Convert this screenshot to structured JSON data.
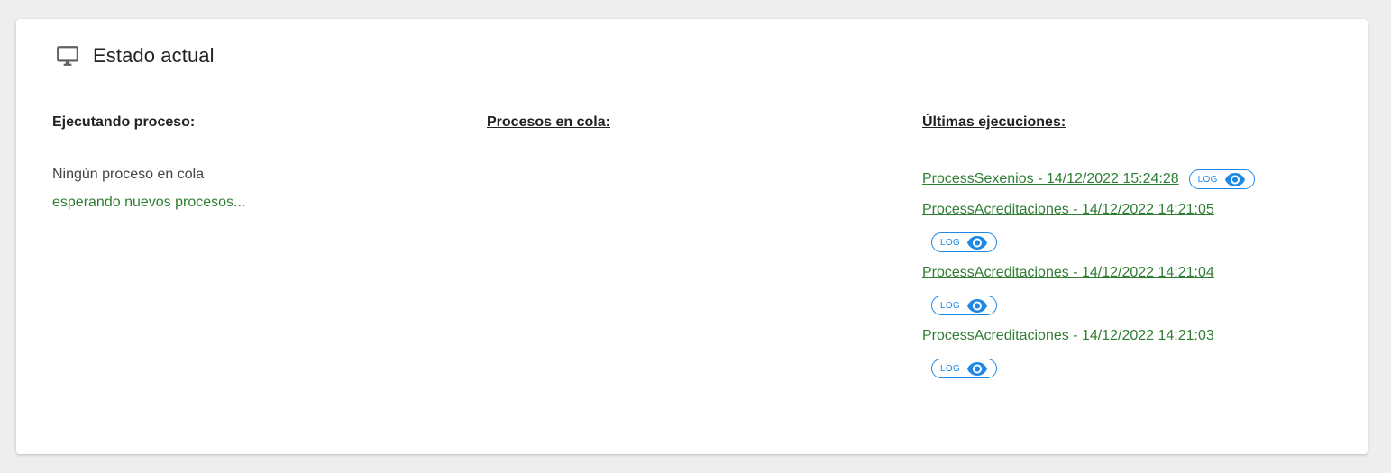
{
  "header": {
    "title": "Estado actual",
    "icon": "monitor-icon"
  },
  "running": {
    "title": "Ejecutando proceso:",
    "status": "Ningún proceso en cola",
    "waiting": "esperando nuevos procesos..."
  },
  "queue": {
    "title": "Procesos en cola:"
  },
  "recent": {
    "title": "Últimas ejecuciones:",
    "items": [
      {
        "label": "ProcessSexenios - 14/12/2022 15:24:28",
        "log_label": "LOG"
      },
      {
        "label": "ProcessAcreditaciones - 14/12/2022 14:21:05",
        "log_label": "LOG"
      },
      {
        "label": "ProcessAcreditaciones - 14/12/2022 14:21:04",
        "log_label": "LOG"
      },
      {
        "label": "ProcessAcreditaciones - 14/12/2022 14:21:03",
        "log_label": "LOG"
      }
    ]
  },
  "colors": {
    "link_green": "#2e7d32",
    "accent_blue": "#1e88e5",
    "background": "#eeeeee"
  }
}
